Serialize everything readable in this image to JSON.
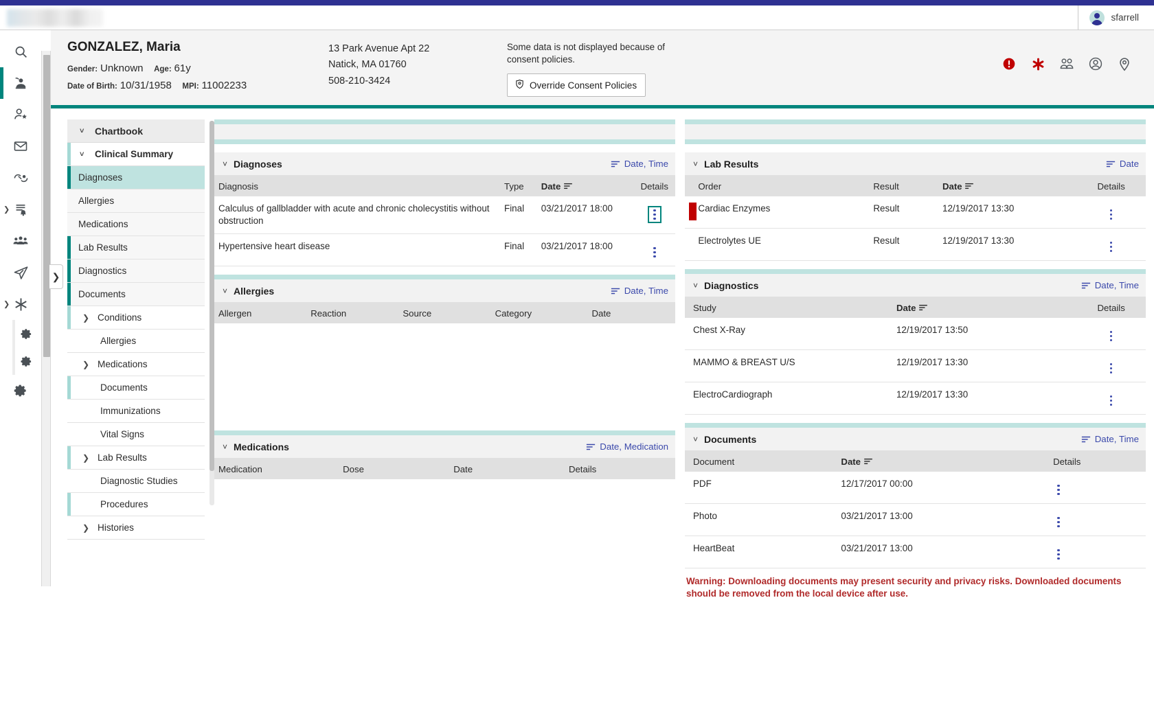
{
  "topbar": {
    "username": "sfarrell",
    "avatar_icon": "user-avatar-icon",
    "logo_alt": "application-logo"
  },
  "icon_rail": [
    {
      "name": "search-icon",
      "glyph": "search"
    },
    {
      "name": "patient-lookup-icon",
      "glyph": "stamp",
      "active": true
    },
    {
      "name": "add-patient-icon",
      "glyph": "user-star"
    },
    {
      "name": "mail-icon",
      "glyph": "envelope"
    },
    {
      "name": "handshake-icon",
      "glyph": "handshake"
    },
    {
      "name": "notifications-list-icon",
      "glyph": "list-bell",
      "caret": true
    },
    {
      "name": "care-team-icon",
      "glyph": "people"
    },
    {
      "name": "send-icon",
      "glyph": "paper-plane"
    },
    {
      "name": "clinical-icon",
      "glyph": "asterisk",
      "caret": true
    },
    {
      "name": "settings-sub-icon-1",
      "glyph": "gear",
      "sub": true
    },
    {
      "name": "settings-sub-icon-2",
      "glyph": "gear",
      "sub": true
    },
    {
      "name": "settings-icon",
      "glyph": "gear"
    }
  ],
  "patient": {
    "name": "GONZALEZ, Maria",
    "gender_label": "Gender:",
    "gender_value": "Unknown",
    "age_label": "Age:",
    "age_value": "61y",
    "dob_label": "Date of Birth:",
    "dob_value": "10/31/1958",
    "mpi_label": "MPI:",
    "mpi_value": "11002233",
    "address_line1": "13 Park Avenue Apt 22",
    "address_line2": "Natick, MA 01760",
    "phone": "508-210-3424",
    "consent_note": "Some data is not displayed because of consent policies.",
    "override_button": "Override Consent Policies",
    "override_icon": "shield-icon",
    "header_icons": [
      {
        "name": "alert-icon",
        "color": "#c00000"
      },
      {
        "name": "medical-asterisk-icon",
        "color": "#c00000"
      },
      {
        "name": "care-team-icon",
        "color": "#555b60"
      },
      {
        "name": "account-icon",
        "color": "#555b60"
      },
      {
        "name": "location-pin-icon",
        "color": "#555b60"
      }
    ]
  },
  "chartbook": {
    "title": "Chartbook",
    "section": "Clinical Summary",
    "items": [
      {
        "label": "Diagnoses",
        "selected": true,
        "bar": "teal"
      },
      {
        "label": "Allergies",
        "selected": false,
        "bar": "none"
      },
      {
        "label": "Medications",
        "selected": false,
        "bar": "none"
      },
      {
        "label": "Lab Results",
        "selected": false,
        "bar": "teal"
      },
      {
        "label": "Diagnostics",
        "selected": false,
        "bar": "teal"
      },
      {
        "label": "Documents",
        "selected": false,
        "bar": "teal"
      }
    ],
    "groups": [
      {
        "label": "Conditions",
        "expandable": true,
        "bar": "ltteal"
      },
      {
        "label": "Allergies",
        "expandable": false,
        "bar": "none"
      },
      {
        "label": "Medications",
        "expandable": true,
        "bar": "none"
      },
      {
        "label": "Documents",
        "expandable": false,
        "bar": "ltteal"
      },
      {
        "label": "Immunizations",
        "expandable": false,
        "bar": "none"
      },
      {
        "label": "Vital Signs",
        "expandable": false,
        "bar": "none"
      },
      {
        "label": "Lab Results",
        "expandable": true,
        "bar": "ltteal"
      },
      {
        "label": "Diagnostic Studies",
        "expandable": false,
        "bar": "none"
      },
      {
        "label": "Procedures",
        "expandable": false,
        "bar": "ltteal"
      },
      {
        "label": "Histories",
        "expandable": true,
        "bar": "none"
      }
    ]
  },
  "panels": {
    "diagnoses": {
      "title": "Diagnoses",
      "sort_label": "Date, Time",
      "columns": [
        "Diagnosis",
        "Type",
        "Date",
        "Details"
      ],
      "sorted_column": "Date",
      "rows": [
        {
          "diagnosis": "Calculus of gallbladder with acute and chronic cholecystitis without obstruction",
          "type": "Final",
          "date": "03/21/2017 18:00",
          "details_focused": true
        },
        {
          "diagnosis": "Hypertensive heart disease",
          "type": "Final",
          "date": "03/21/2017 18:00",
          "details_focused": false
        }
      ]
    },
    "allergies": {
      "title": "Allergies",
      "sort_label": "Date, Time",
      "columns": [
        "Allergen",
        "Reaction",
        "Source",
        "Category",
        "Date"
      ],
      "rows": []
    },
    "medications": {
      "title": "Medications",
      "sort_label": "Date, Medication",
      "columns": [
        "Medication",
        "Dose",
        "Date",
        "Details"
      ],
      "rows": []
    },
    "lab_results": {
      "title": "Lab Results",
      "sort_label": "Date",
      "columns": [
        "Order",
        "Result",
        "Date",
        "Details"
      ],
      "sorted_column": "Date",
      "rows": [
        {
          "flag": "#c00000",
          "order": "Cardiac Enzymes",
          "result": "Result",
          "date": "12/19/2017 13:30"
        },
        {
          "flag": "",
          "order": "Electrolytes UE",
          "result": "Result",
          "date": "12/19/2017 13:30"
        }
      ]
    },
    "diagnostics": {
      "title": "Diagnostics",
      "sort_label": "Date, Time",
      "columns": [
        "Study",
        "Date",
        "Details"
      ],
      "sorted_column": "Date",
      "rows": [
        {
          "study": "Chest X-Ray",
          "date": "12/19/2017 13:50"
        },
        {
          "study": "MAMMO & BREAST U/S",
          "date": "12/19/2017 13:30"
        },
        {
          "study": "ElectroCardiograph",
          "date": "12/19/2017 13:30"
        }
      ]
    },
    "documents": {
      "title": "Documents",
      "sort_label": "Date, Time",
      "columns": [
        "Document",
        "Date",
        "Details"
      ],
      "sorted_column": "Date",
      "rows": [
        {
          "document": "PDF",
          "date": "12/17/2017 00:00"
        },
        {
          "document": "Photo",
          "date": "03/21/2017 13:00"
        },
        {
          "document": "HeartBeat",
          "date": "03/21/2017 13:00"
        }
      ],
      "warning": "Warning: Downloading documents may present security and privacy risks. Downloaded documents should be removed from the local device after use."
    }
  },
  "colors": {
    "brand_navy": "#2e3192",
    "brand_teal": "#00857d",
    "accent_light_teal": "#bfe3e0",
    "link": "#3b49ab",
    "alert_red": "#c00000",
    "warning_red": "#b02a2a"
  }
}
